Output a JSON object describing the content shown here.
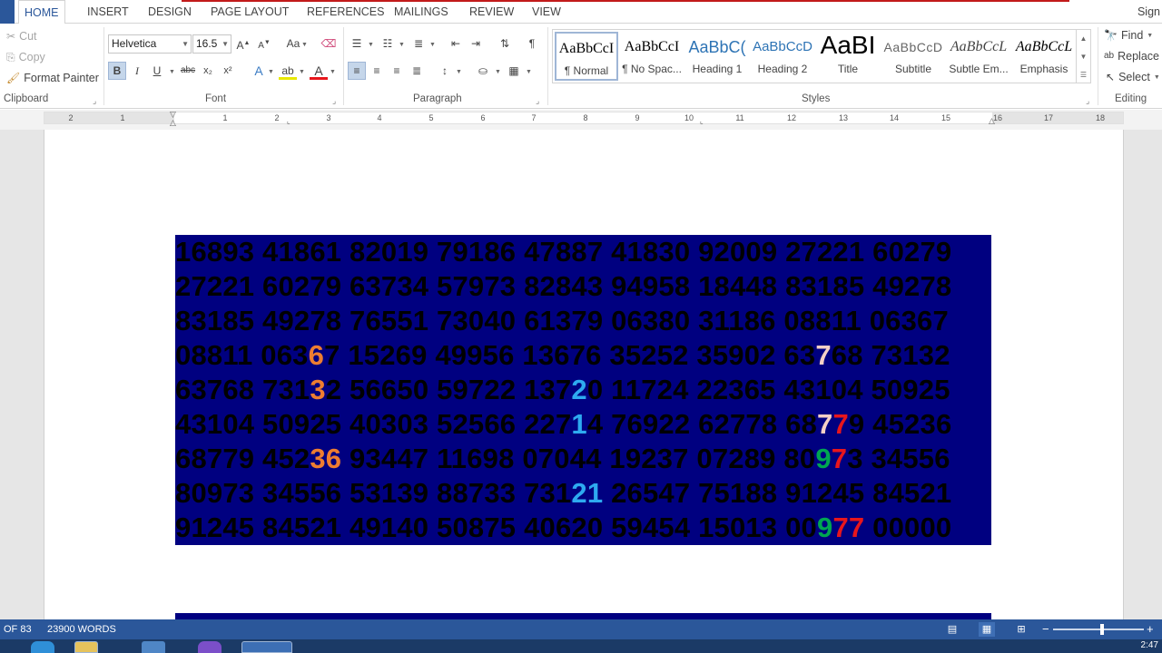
{
  "tabs": [
    {
      "label": "HOME",
      "active": true
    },
    {
      "label": "INSERT"
    },
    {
      "label": "DESIGN"
    },
    {
      "label": "PAGE LAYOUT"
    },
    {
      "label": "REFERENCES"
    },
    {
      "label": "MAILINGS"
    },
    {
      "label": "REVIEW"
    },
    {
      "label": "VIEW"
    }
  ],
  "sign_in": "Sign",
  "clipboard": {
    "cut": "Cut",
    "copy": "Copy",
    "format_painter": "Format Painter",
    "label": "Clipboard"
  },
  "font": {
    "family": "Helvetica",
    "size": "16.5",
    "label": "Font",
    "change_case": "Aa",
    "bold": "B",
    "italic": "I",
    "underline": "U",
    "strike": "abc",
    "subscript": "x₂",
    "superscript": "x²"
  },
  "paragraph": {
    "label": "Paragraph"
  },
  "styles": {
    "label": "Styles",
    "items": [
      {
        "preview": "AaBbCcI",
        "name": "¶ Normal",
        "selected": true
      },
      {
        "preview": "AaBbCcI",
        "name": "¶ No Spac..."
      },
      {
        "preview": "AaBbC(",
        "name": "Heading 1"
      },
      {
        "preview": "AaBbCcD",
        "name": "Heading 2"
      },
      {
        "preview": "AaBI",
        "name": "Title"
      },
      {
        "preview": "AaBbCcD",
        "name": "Subtitle"
      },
      {
        "preview": "AaBbCcL",
        "name": "Subtle Em..."
      },
      {
        "preview": "AaBbCcL",
        "name": "Emphasis"
      }
    ]
  },
  "editing": {
    "find": "Find",
    "replace": "Replace",
    "select": "Select",
    "label": "Editing"
  },
  "ruler_numbers": [
    "2",
    "1",
    "1",
    "2",
    "3",
    "4",
    "5",
    "6",
    "7",
    "8",
    "9",
    "10",
    "11",
    "12",
    "13",
    "14",
    "15",
    "16",
    "17",
    "18"
  ],
  "document": {
    "lines": [
      [
        {
          "t": "16893 41861 82019 79186 47887 41830 92009 27221 60279"
        }
      ],
      [
        {
          "t": "27221 60279 63734 57973 82843 94958 18448 83185 49278"
        }
      ],
      [
        {
          "t": "83185 49278 76551 73040 61379 06380 31186 08811 06367"
        }
      ],
      [
        {
          "t": "08811 063"
        },
        {
          "t": "6",
          "c": "orange"
        },
        {
          "t": "7 15269 49956 13676 35252 35902 63"
        },
        {
          "t": "7",
          "c": "pink"
        },
        {
          "t": "68 73132"
        }
      ],
      [
        {
          "t": "63768 731"
        },
        {
          "t": "3",
          "c": "orange"
        },
        {
          "t": "2 56650 59722 137"
        },
        {
          "t": "2",
          "c": "blue"
        },
        {
          "t": "0 11724 22365 43104 50925"
        }
      ],
      [
        {
          "t": "43104 50925 40303 52566 227"
        },
        {
          "t": "1",
          "c": "blue"
        },
        {
          "t": "4 76922 62778 68"
        },
        {
          "t": "7",
          "c": "pink"
        },
        {
          "t": "7",
          "c": "red"
        },
        {
          "t": "9 45236"
        }
      ],
      [
        {
          "t": "68779 452"
        },
        {
          "t": "36",
          "c": "orange"
        },
        {
          "t": " 93447 11698 07044 19237 07289 80"
        },
        {
          "t": "9",
          "c": "green"
        },
        {
          "t": "7",
          "c": "red"
        },
        {
          "t": "3 34556"
        }
      ],
      [
        {
          "t": "80973 34556 53139 88733 731"
        },
        {
          "t": "21",
          "c": "blue"
        },
        {
          "t": " 26547 75188 91245 84521"
        }
      ],
      [
        {
          "t": "91245 84521 49140 50875 40620 59454 15013 00"
        },
        {
          "t": "9",
          "c": "green"
        },
        {
          "t": "77",
          "c": "red"
        },
        {
          "t": " 00000"
        }
      ]
    ]
  },
  "status": {
    "page": "OF 83",
    "words": "23900 WORDS"
  },
  "clock": "2:47",
  "colors": {
    "accent": "#2b579a",
    "block_bg": "#000080",
    "orange": "#ed7d31",
    "blue": "#2eaaf0",
    "pink": "#f4d0c6",
    "red": "#e8161c",
    "green": "#00a651"
  }
}
